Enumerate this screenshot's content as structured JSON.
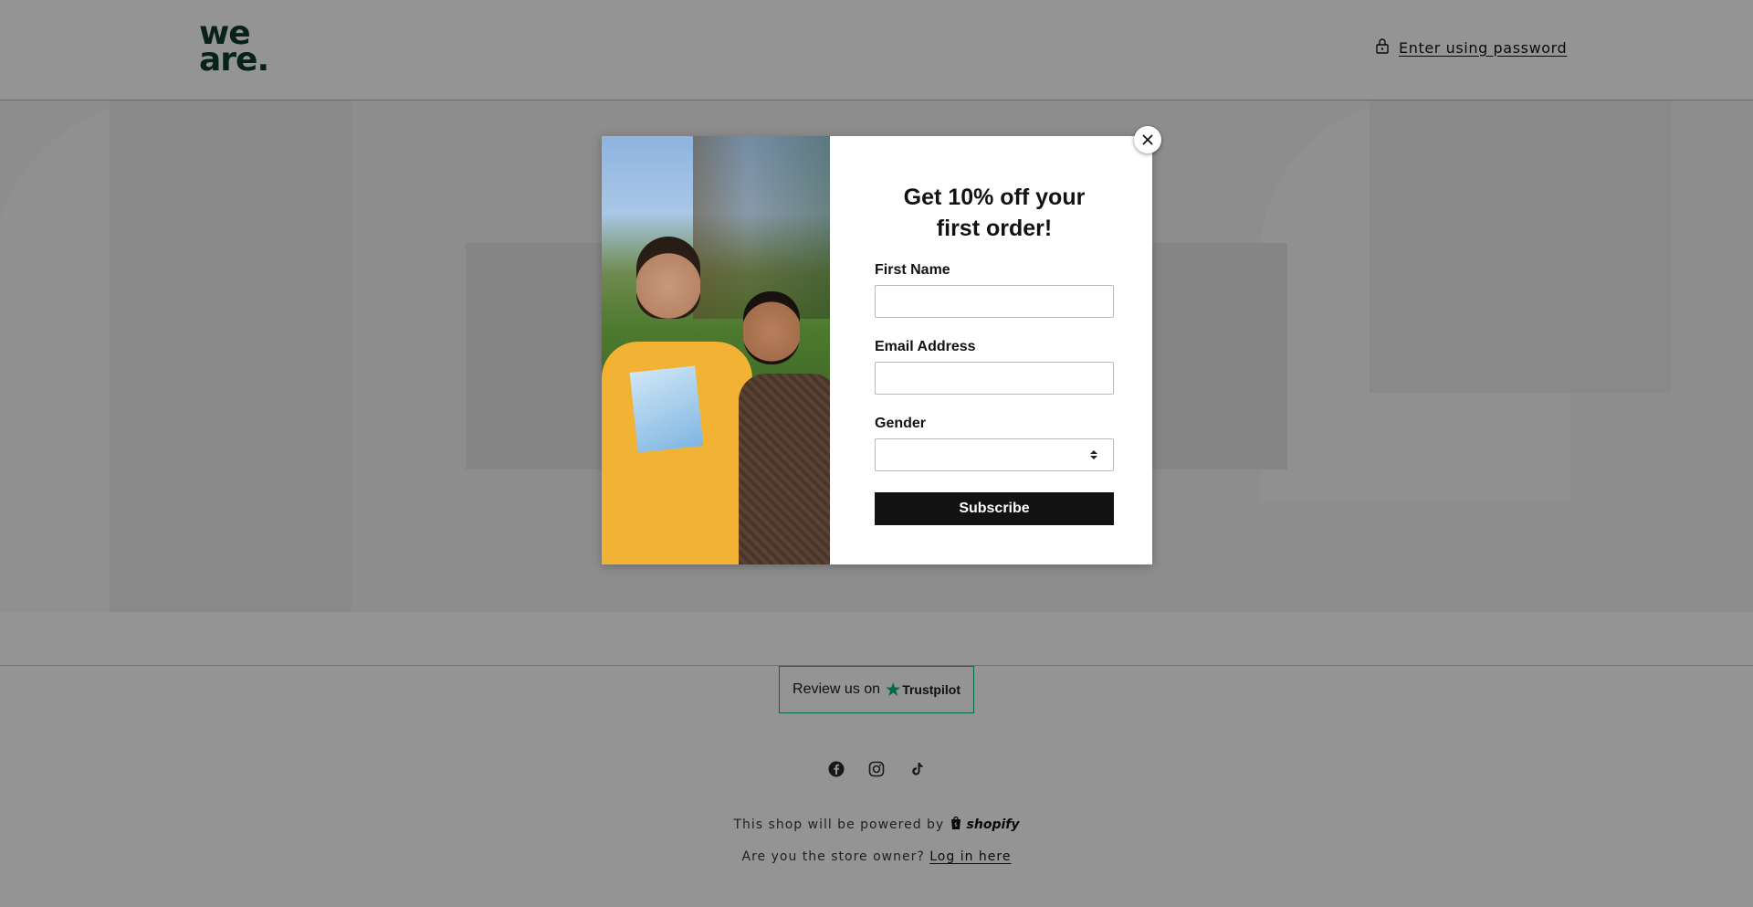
{
  "header": {
    "logo_line1": "we",
    "logo_line2": "are.",
    "password_link": "Enter using password"
  },
  "footer": {
    "trustpilot_prefix": "Review us on",
    "trustpilot_brand": "Trustpilot",
    "social_icons": [
      "facebook-icon",
      "instagram-icon",
      "tiktok-icon"
    ],
    "powered_by": "This shop will be powered by",
    "shopify_label": "shopify",
    "owner_question": "Are you the store owner?",
    "login_link": "Log in here"
  },
  "modal": {
    "title": "Get 10% off your first order!",
    "fields": {
      "first_name_label": "First Name",
      "first_name_value": "",
      "email_label": "Email Address",
      "email_value": "",
      "gender_label": "Gender",
      "gender_value": ""
    },
    "subscribe_label": "Subscribe",
    "close_icon": "close-icon"
  },
  "colors": {
    "brand_green": "#0e3b2c",
    "trustpilot_green": "#00b67a",
    "button_black": "#121212",
    "overlay": "rgba(0,0,0,0.42)"
  }
}
